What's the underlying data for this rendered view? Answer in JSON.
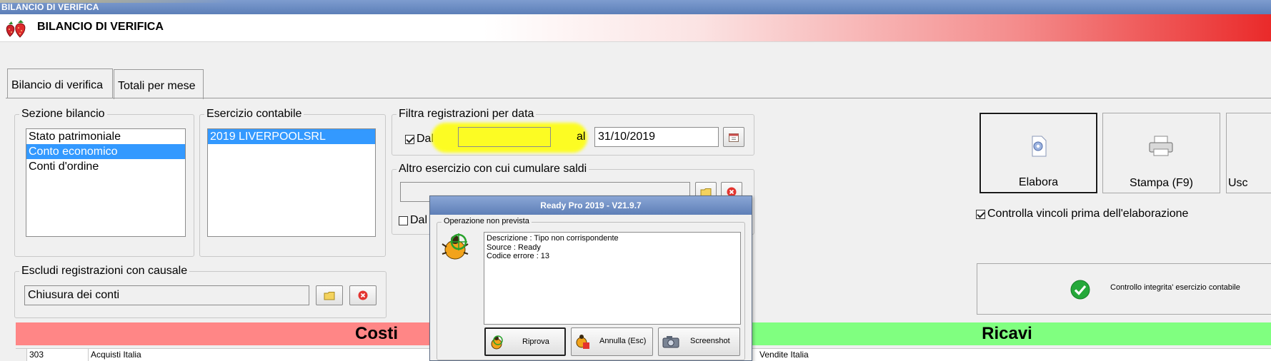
{
  "window": {
    "title": "BILANCIO DI VERIFICA"
  },
  "header": {
    "title": "BILANCIO DI VERIFICA",
    "logo_icon": "strawberry-icon"
  },
  "tabs": [
    {
      "label": "Bilancio di verifica",
      "active": true
    },
    {
      "label": "Totali per mese",
      "active": false
    }
  ],
  "sezione_bilancio": {
    "legend": "Sezione bilancio",
    "items": [
      "Stato patrimoniale",
      "Conto economico",
      "Conti d'ordine"
    ],
    "selected": "Conto economico"
  },
  "esercizio_contabile": {
    "legend": "Esercizio contabile",
    "items": [
      "2019 LIVERPOOLSRL"
    ],
    "selected": "2019 LIVERPOOLSRL"
  },
  "filtra_data": {
    "legend": "Filtra registrazioni per data",
    "dal_label": "Dal",
    "dal_checked": true,
    "dal_value": "",
    "al_label": "al",
    "al_value": "31/10/2019",
    "highlight_color": "#ffff00"
  },
  "altro_esercizio": {
    "legend": "Altro esercizio con cui cumulare saldi",
    "value": "",
    "dal_label": "Dal",
    "dal_checked": false
  },
  "escludi_causale": {
    "legend": "Escludi registrazioni con causale",
    "value": "Chiusura dei conti"
  },
  "actions": {
    "elabora": "Elabora",
    "stampa": "Stampa (F9)",
    "esci": "Usc"
  },
  "controlla_vincoli": {
    "label": "Controlla vincoli prima dell'elaborazione",
    "checked": true
  },
  "controllo_integrita": {
    "label": "Controllo integrita' esercizio contabile"
  },
  "costi": {
    "header": "Costi",
    "color": "#ff8686",
    "row": {
      "code": "303",
      "description": "Acquisti Italia"
    }
  },
  "ricavi": {
    "header": "Ricavi",
    "color": "#80ff80",
    "row": {
      "description": "Vendite Italia"
    }
  },
  "dialog": {
    "title": "Ready Pro 2019 - V21.9.7",
    "group_legend": "Operazione non prevista",
    "lines": [
      "Descrizione : Tipo non corrispondente",
      "Source : Ready",
      "Codice errore : 13"
    ],
    "buttons": {
      "riprova": "Riprova",
      "annulla": "Annulla (Esc)",
      "screenshot": "Screenshot"
    }
  }
}
